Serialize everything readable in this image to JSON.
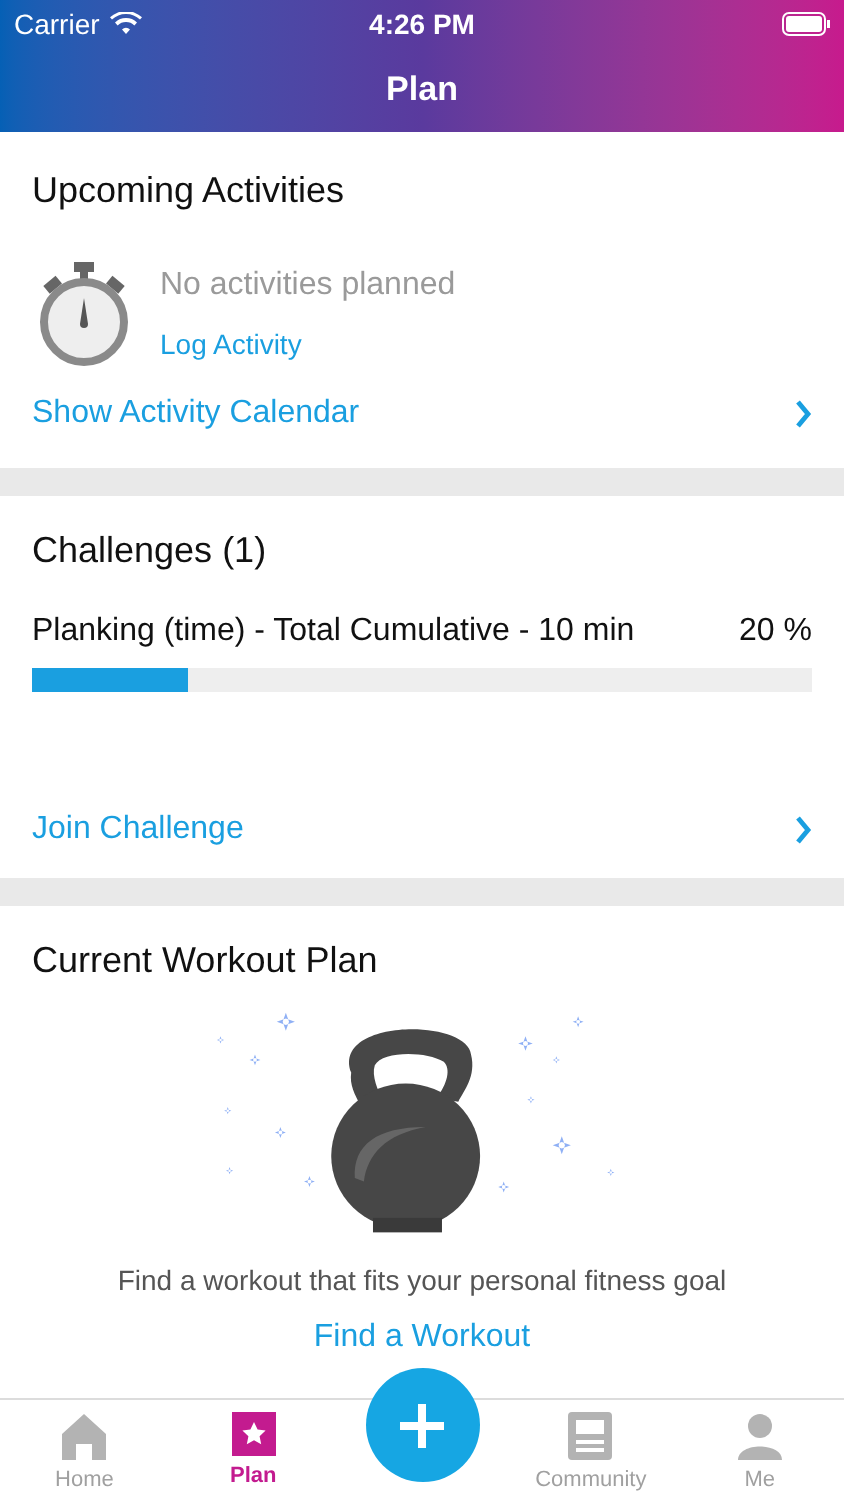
{
  "status_bar": {
    "carrier": "Carrier",
    "time": "4:26 PM"
  },
  "nav": {
    "title": "Plan"
  },
  "upcoming": {
    "title": "Upcoming Activities",
    "empty_text": "No activities planned",
    "action": "Log Activity",
    "link": "Show Activity Calendar"
  },
  "challenges": {
    "title": "Challenges (1)",
    "items": [
      {
        "name": "Planking (time) - Total Cumulative - 10 min",
        "percent": "20 %",
        "level": 0.2
      }
    ],
    "link": "Join Challenge"
  },
  "workout_plan": {
    "title": "Current Workout Plan",
    "description": "Find a workout that fits your personal fitness goal",
    "action": "Find a Workout"
  },
  "tabs": [
    {
      "label": "Home",
      "kind": "home",
      "selected": false
    },
    {
      "label": "Plan",
      "kind": "plan",
      "selected": true
    },
    {
      "kind": "add"
    },
    {
      "label": "Community",
      "kind": "community",
      "selected": false
    },
    {
      "label": "Me",
      "kind": "me",
      "selected": false
    }
  ]
}
